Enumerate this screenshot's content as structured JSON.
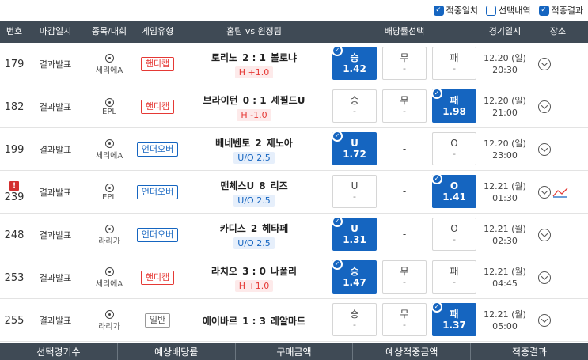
{
  "filters": [
    {
      "label": "적중일치",
      "checked": true
    },
    {
      "label": "선택내역",
      "checked": false
    },
    {
      "label": "적중결과",
      "checked": true
    }
  ],
  "headers": {
    "no": "번호",
    "deadline": "마감일시",
    "league": "종목/대회",
    "type": "게임유형",
    "match": "홈팀 vs 원정팀",
    "odds": "배당률선택",
    "date": "경기일시",
    "place": "장소"
  },
  "rows": [
    {
      "no": "179",
      "alert": false,
      "deadline": "결과발표",
      "league": "세리에A",
      "type": "핸디캡",
      "type_color": "red",
      "home": "토리노",
      "score": "2 : 1",
      "away": "볼로냐",
      "sub": "H +1.0",
      "sub_color": "red",
      "b1": {
        "lab": "승",
        "val": "1.42",
        "sel": true
      },
      "b2": {
        "lab": "무",
        "val": "-",
        "sel": false,
        "plain": false
      },
      "b3": {
        "lab": "패",
        "val": "-",
        "sel": false
      },
      "date1": "12.20 (일)",
      "date2": "20:30",
      "chart": false
    },
    {
      "no": "182",
      "alert": false,
      "deadline": "결과발표",
      "league": "EPL",
      "type": "핸디캡",
      "type_color": "red",
      "home": "브라이턴",
      "score": "0 : 1",
      "away": "셰필드U",
      "sub": "H -1.0",
      "sub_color": "red",
      "b1": {
        "lab": "승",
        "val": "-",
        "sel": false
      },
      "b2": {
        "lab": "무",
        "val": "-",
        "sel": false,
        "plain": false
      },
      "b3": {
        "lab": "패",
        "val": "1.98",
        "sel": true
      },
      "date1": "12.20 (일)",
      "date2": "21:00",
      "chart": false
    },
    {
      "no": "199",
      "alert": false,
      "deadline": "결과발표",
      "league": "세리에A",
      "type": "언더오버",
      "type_color": "blue",
      "home": "베네벤토",
      "score": "2",
      "away": "제노아",
      "sub": "U/O 2.5",
      "sub_color": "blue",
      "b1": {
        "lab": "U",
        "val": "1.72",
        "sel": true
      },
      "b2": {
        "lab": "-",
        "val": "",
        "sel": false,
        "plain": true
      },
      "b3": {
        "lab": "O",
        "val": "-",
        "sel": false
      },
      "date1": "12.20 (일)",
      "date2": "23:00",
      "chart": false
    },
    {
      "no": "239",
      "alert": true,
      "deadline": "결과발표",
      "league": "EPL",
      "type": "언더오버",
      "type_color": "blue",
      "home": "맨체스U",
      "score": "8",
      "away": "리즈",
      "sub": "U/O 2.5",
      "sub_color": "blue",
      "b1": {
        "lab": "U",
        "val": "-",
        "sel": false
      },
      "b2": {
        "lab": "-",
        "val": "",
        "sel": false,
        "plain": true
      },
      "b3": {
        "lab": "O",
        "val": "1.41",
        "sel": true
      },
      "date1": "12.21 (월)",
      "date2": "01:30",
      "chart": true
    },
    {
      "no": "248",
      "alert": false,
      "deadline": "결과발표",
      "league": "라리가",
      "type": "언더오버",
      "type_color": "blue",
      "home": "카디스",
      "score": "2",
      "away": "헤타페",
      "sub": "U/O 2.5",
      "sub_color": "blue",
      "b1": {
        "lab": "U",
        "val": "1.31",
        "sel": true
      },
      "b2": {
        "lab": "-",
        "val": "",
        "sel": false,
        "plain": true
      },
      "b3": {
        "lab": "O",
        "val": "-",
        "sel": false
      },
      "date1": "12.21 (월)",
      "date2": "02:30",
      "chart": false
    },
    {
      "no": "253",
      "alert": false,
      "deadline": "결과발표",
      "league": "세리에A",
      "type": "핸디캡",
      "type_color": "red",
      "home": "라치오",
      "score": "3 : 0",
      "away": "나폴리",
      "sub": "H +1.0",
      "sub_color": "red",
      "b1": {
        "lab": "승",
        "val": "1.47",
        "sel": true
      },
      "b2": {
        "lab": "무",
        "val": "-",
        "sel": false,
        "plain": false
      },
      "b3": {
        "lab": "패",
        "val": "-",
        "sel": false
      },
      "date1": "12.21 (월)",
      "date2": "04:45",
      "chart": false
    },
    {
      "no": "255",
      "alert": false,
      "deadline": "결과발표",
      "league": "라리가",
      "type": "일반",
      "type_color": "gray",
      "home": "에이바르",
      "score": "1 : 3",
      "away": "레알마드",
      "sub": "",
      "sub_color": "",
      "b1": {
        "lab": "승",
        "val": "-",
        "sel": false
      },
      "b2": {
        "lab": "무",
        "val": "-",
        "sel": false,
        "plain": false
      },
      "b3": {
        "lab": "패",
        "val": "1.37",
        "sel": true
      },
      "date1": "12.21 (월)",
      "date2": "05:00",
      "chart": false
    }
  ],
  "footer": [
    "선택경기수",
    "예상배당률",
    "구매금액",
    "예상적중금액",
    "적중결과"
  ],
  "colors": {
    "accent": "#1565c0",
    "header_bg": "#3f4a55",
    "handicap": "#e53935",
    "alert": "#d32f2f"
  }
}
